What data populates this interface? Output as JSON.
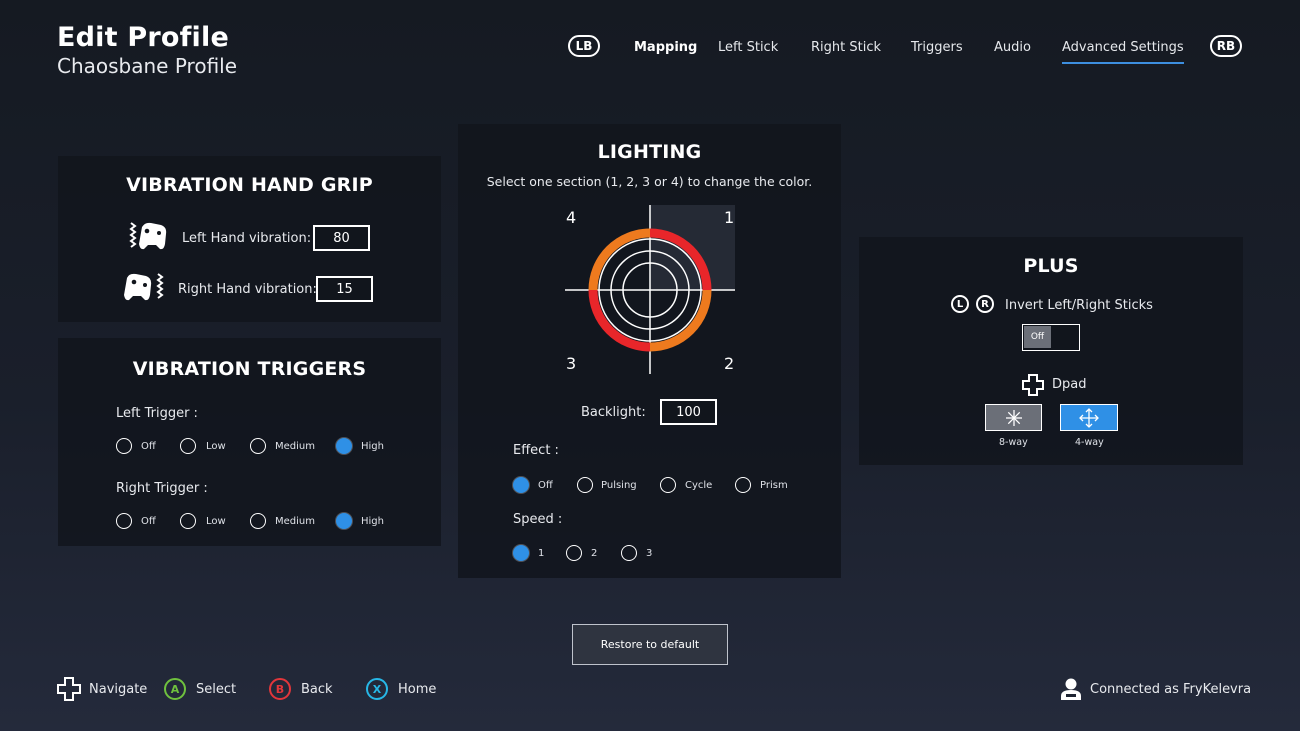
{
  "header": {
    "title": "Edit Profile",
    "subtitle": "Chaosbane Profile"
  },
  "tabs": {
    "left_bumper": "LB",
    "right_bumper": "RB",
    "items": [
      {
        "label": "Mapping"
      },
      {
        "label": "Left Stick"
      },
      {
        "label": "Right Stick"
      },
      {
        "label": "Triggers"
      },
      {
        "label": "Audio"
      },
      {
        "label": "Advanced Settings",
        "active": true
      }
    ]
  },
  "hand_grip": {
    "title": "VIBRATION HAND GRIP",
    "left_label": "Left Hand vibration:",
    "left_value": "80",
    "right_label": "Right Hand vibration:",
    "right_value": "15"
  },
  "triggers": {
    "title": "VIBRATION TRIGGERS",
    "left_label": "Left Trigger :",
    "right_label": "Right Trigger :",
    "options": [
      "Off",
      "Low",
      "Medium",
      "High"
    ],
    "left_selected": "High",
    "right_selected": "High"
  },
  "lighting": {
    "title": "LIGHTING",
    "instruction": "Select one section (1, 2, 3 or 4) to change the color.",
    "sections": [
      "1",
      "2",
      "3",
      "4"
    ],
    "selected_section": "1",
    "ring_colors": [
      "#e8262a",
      "#ee7a1e"
    ],
    "backlight_label": "Backlight:",
    "backlight_value": "100",
    "effect_label": "Effect :",
    "effect_options": [
      "Off",
      "Pulsing",
      "Cycle",
      "Prism"
    ],
    "effect_selected": "Off",
    "speed_label": "Speed :",
    "speed_options": [
      "1",
      "2",
      "3"
    ],
    "speed_selected": "1"
  },
  "plus": {
    "title": "PLUS",
    "stick_icons": [
      "L",
      "R"
    ],
    "invert_label": "Invert Left/Right Sticks",
    "invert_value": "Off",
    "dpad_label": "Dpad",
    "dpad_options": [
      "8-way",
      "4-way"
    ],
    "dpad_selected": "4-way"
  },
  "restore_label": "Restore to default",
  "footer": {
    "navigate": "Navigate",
    "a_button": "A",
    "select": "Select",
    "b_button": "B",
    "back": "Back",
    "x_button": "X",
    "home": "Home",
    "connected": "Connected as FryKelevra"
  },
  "colors": {
    "accent": "#2f90e6",
    "a": "#6fc13e",
    "b": "#e2363b",
    "x": "#27b7e6"
  }
}
